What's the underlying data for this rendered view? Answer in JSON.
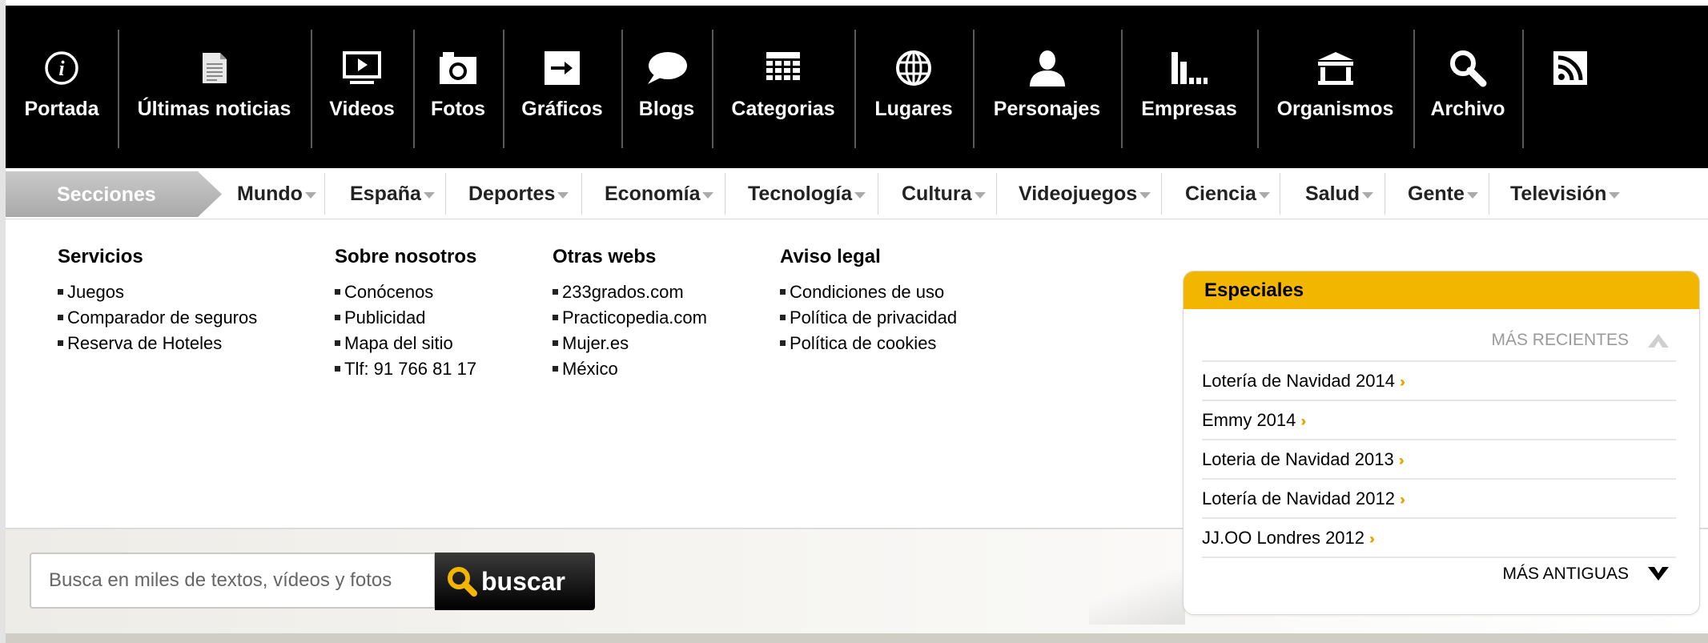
{
  "top_nav": {
    "items": [
      {
        "label": "Portada",
        "icon": "info-icon"
      },
      {
        "label": "Últimas noticias",
        "icon": "document-icon"
      },
      {
        "label": "Videos",
        "icon": "video-icon"
      },
      {
        "label": "Fotos",
        "icon": "camera-icon"
      },
      {
        "label": "Gráficos",
        "icon": "arrow-right-icon"
      },
      {
        "label": "Blogs",
        "icon": "speech-bubble-icon"
      },
      {
        "label": "Categorias",
        "icon": "grid-icon"
      },
      {
        "label": "Lugares",
        "icon": "globe-icon"
      },
      {
        "label": "Personajes",
        "icon": "person-icon"
      },
      {
        "label": "Empresas",
        "icon": "bar-chart-icon"
      },
      {
        "label": "Organismos",
        "icon": "building-icon"
      },
      {
        "label": "Archivo",
        "icon": "search-icon"
      },
      {
        "label": "",
        "icon": "rss-icon"
      }
    ]
  },
  "sections_bar": {
    "title": "Secciones",
    "items": [
      "Mundo",
      "España",
      "Deportes",
      "Economía",
      "Tecnología",
      "Cultura",
      "Videojuegos",
      "Ciencia",
      "Salud",
      "Gente",
      "Televisión"
    ]
  },
  "footer_columns": [
    {
      "title": "Servicios",
      "links": [
        "Juegos",
        "Comparador de seguros",
        "Reserva de Hoteles"
      ]
    },
    {
      "title": "Sobre nosotros",
      "links": [
        "Conócenos",
        "Publicidad",
        "Mapa del sitio",
        "Tlf: 91 766 81 17"
      ]
    },
    {
      "title": "Otras webs",
      "links": [
        "233grados.com",
        "Practicopedia.com",
        "Mujer.es",
        "México"
      ]
    },
    {
      "title": "Aviso legal",
      "links": [
        "Condiciones de uso",
        "Política de privacidad",
        "Política de cookies"
      ]
    }
  ],
  "especiales": {
    "title": "Especiales",
    "more_recent": "MÁS RECIENTES",
    "older": "MÁS ANTIGUAS",
    "items": [
      "Lotería de Navidad 2014",
      "Emmy 2014",
      "Loteria de Navidad 2013",
      "Lotería de Navidad 2012",
      "JJ.OO Londres 2012"
    ]
  },
  "search": {
    "placeholder": "Busca en miles de textos, vídeos y fotos",
    "button_label": "buscar"
  },
  "colors": {
    "top_bar": "#000000",
    "accent": "#f2b600",
    "sections_tab": "#b5b5b5",
    "chevron": "#e0a800"
  }
}
